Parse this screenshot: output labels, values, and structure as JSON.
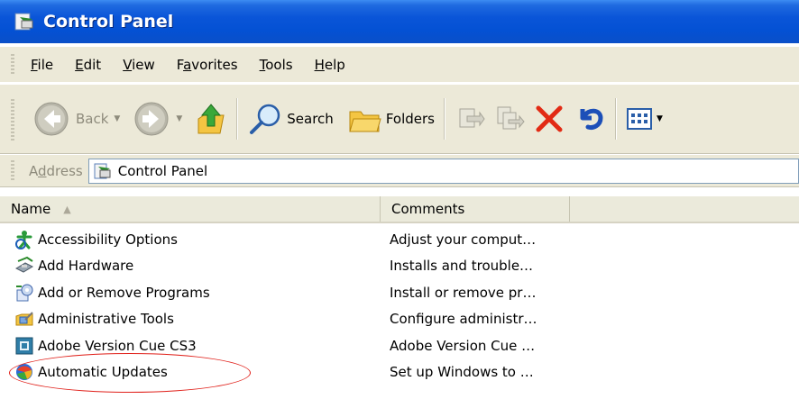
{
  "window": {
    "title": "Control Panel"
  },
  "menu": {
    "items": [
      {
        "label": "File",
        "u": "F",
        "rest": "ile"
      },
      {
        "label": "Edit",
        "u": "E",
        "rest": "dit"
      },
      {
        "label": "View",
        "u": "V",
        "rest": "iew"
      },
      {
        "label": "Favorites",
        "pre": "F",
        "u": "a",
        "rest": "vorites"
      },
      {
        "label": "Tools",
        "u": "T",
        "rest": "ools"
      },
      {
        "label": "Help",
        "u": "H",
        "rest": "elp"
      }
    ]
  },
  "toolbar": {
    "back_label": "Back",
    "search_label": "Search",
    "folders_label": "Folders"
  },
  "address": {
    "label_pre": "A",
    "label_u": "d",
    "label_rest": "dress",
    "value": "Control Panel"
  },
  "columns": {
    "name": "Name",
    "comments": "Comments"
  },
  "rows": [
    {
      "name": "Accessibility Options",
      "comment": "Adjust your comput…",
      "icon": "accessibility-icon"
    },
    {
      "name": "Add Hardware",
      "comment": "Installs and trouble…",
      "icon": "add-hardware-icon"
    },
    {
      "name": "Add or Remove Programs",
      "comment": "Install or remove pr…",
      "icon": "add-remove-programs-icon"
    },
    {
      "name": "Administrative Tools",
      "comment": "Configure administr…",
      "icon": "administrative-tools-icon"
    },
    {
      "name": "Adobe Version Cue CS3",
      "comment": "Adobe Version Cue …",
      "icon": "adobe-version-cue-icon"
    },
    {
      "name": "Automatic Updates",
      "comment": "Set up Windows to …",
      "icon": "automatic-updates-icon"
    }
  ],
  "colors": {
    "title_blue": "#0451d4",
    "chrome": "#ece9d8",
    "highlight_red": "#e0201a"
  }
}
